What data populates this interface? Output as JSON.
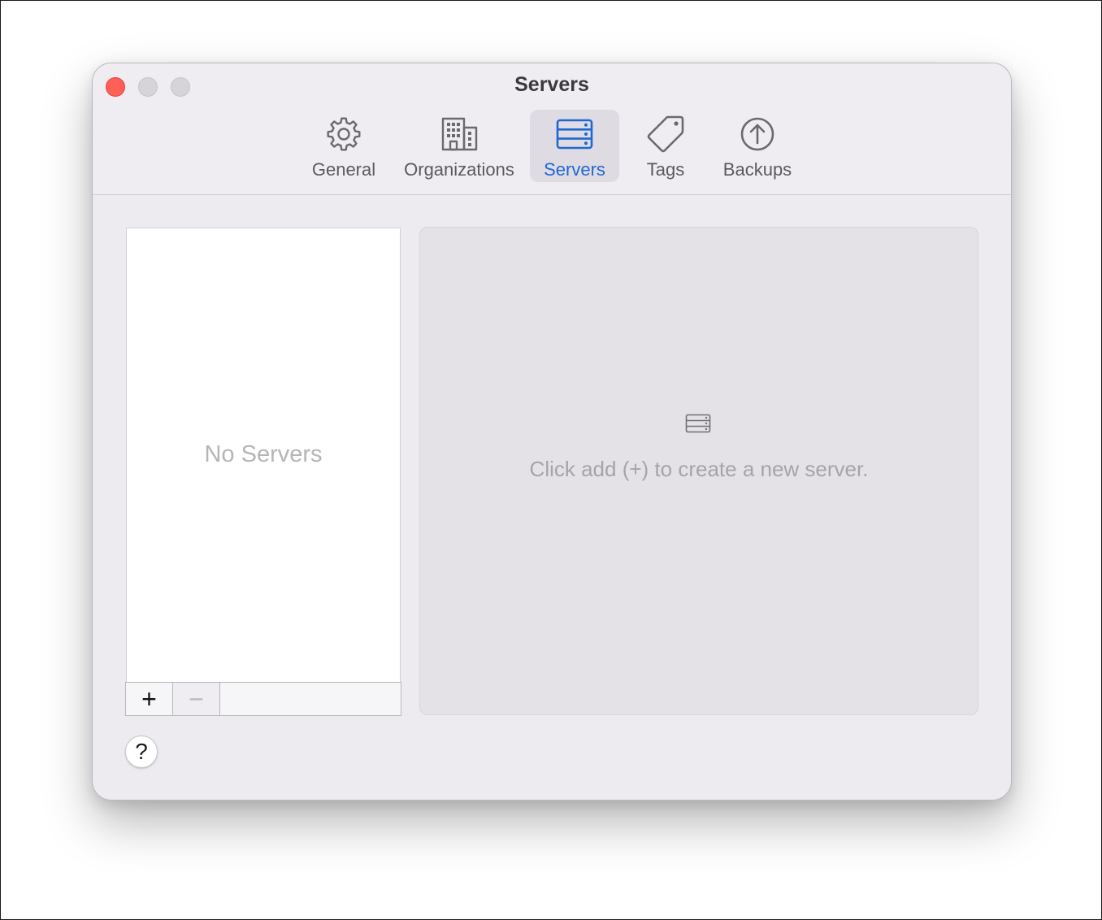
{
  "window": {
    "title": "Servers"
  },
  "toolbar": {
    "tabs": [
      {
        "label": "General",
        "icon": "gear-icon",
        "selected": false
      },
      {
        "label": "Organizations",
        "icon": "building-icon",
        "selected": false
      },
      {
        "label": "Servers",
        "icon": "server-rack-icon",
        "selected": true
      },
      {
        "label": "Tags",
        "icon": "tag-icon",
        "selected": false
      },
      {
        "label": "Backups",
        "icon": "arrow-up-circle-icon",
        "selected": false
      }
    ]
  },
  "server_list": {
    "empty_text": "No Servers",
    "controls": {
      "add_label": "+",
      "remove_label": "−",
      "remove_enabled": false
    }
  },
  "detail": {
    "icon": "server-rack-icon",
    "hint": "Click add (+) to create a new server."
  },
  "help": {
    "label": "?"
  },
  "colors": {
    "accent": "#1f68d3",
    "close_button": "#fe5f57",
    "window_background": "#edebf0"
  }
}
